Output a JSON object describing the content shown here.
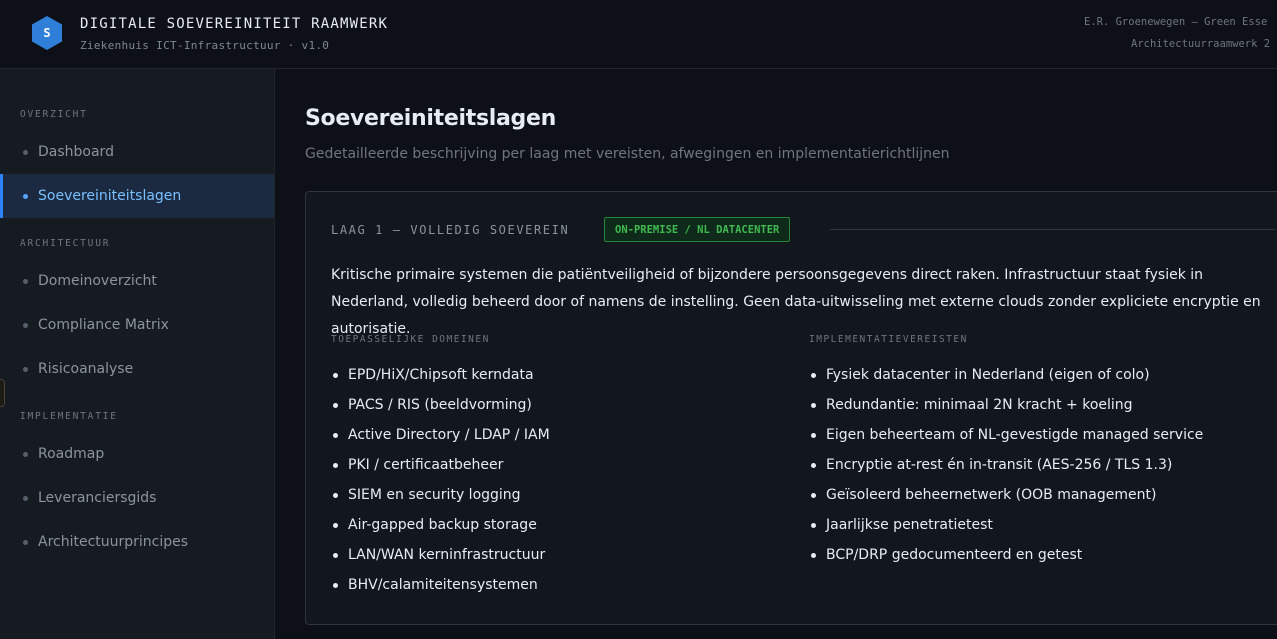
{
  "header": {
    "logo_letter": "S",
    "title": "DIGITALE SOEVEREINITEIT RAAMWERK",
    "subtitle": "Ziekenhuis ICT-Infrastructuur · v1.0",
    "author_line": "E.R. Groenewegen — Green Esse",
    "doc_line": "Architectuurraamwerk 2"
  },
  "sidebar": {
    "sections": [
      {
        "label": "OVERZICHT",
        "items": [
          {
            "label": "Dashboard",
            "active": false
          },
          {
            "label": "Soevereiniteitslagen",
            "active": true
          }
        ]
      },
      {
        "label": "ARCHITECTUUR",
        "items": [
          {
            "label": "Domeinoverzicht",
            "active": false
          },
          {
            "label": "Compliance Matrix",
            "active": false
          },
          {
            "label": "Risicoanalyse",
            "active": false
          }
        ]
      },
      {
        "label": "IMPLEMENTATIE",
        "items": [
          {
            "label": "Roadmap",
            "active": false
          },
          {
            "label": "Leveranciersgids",
            "active": false
          },
          {
            "label": "Architectuurprincipes",
            "active": false
          }
        ]
      }
    ]
  },
  "main": {
    "title": "Soevereiniteitslagen",
    "subtitle": "Gedetailleerde beschrijving per laag met vereisten, afwegingen en implementatierichtlijnen",
    "layer": {
      "label": "LAAG 1 — VOLLEDIG SOEVEREIN",
      "badge": "ON-PREMISE / NL DATACENTER",
      "badge_color": "#3fb950",
      "description": "Kritische primaire systemen die patiëntveiligheid of bijzondere persoonsgegevens direct raken. Infrastructuur staat fysiek in Nederland, volledig beheerd door of namens de instelling. Geen data-uitwisseling met externe clouds zonder expliciete encryptie en autorisatie.",
      "domains_heading": "TOEPASSELIJKE DOMEINEN",
      "domains": [
        "EPD/HiX/Chipsoft kerndata",
        "PACS / RIS (beeldvorming)",
        "Active Directory / LDAP / IAM",
        "PKI / certificaatbeheer",
        "SIEM en security logging",
        "Air-gapped backup storage",
        "LAN/WAN kerninfrastructuur",
        "BHV/calamiteitensystemen"
      ],
      "requirements_heading": "IMPLEMENTATIEVEREISTEN",
      "requirements": [
        "Fysiek datacenter in Nederland (eigen of colo)",
        "Redundantie: minimaal 2N kracht + koeling",
        "Eigen beheerteam of NL-gevestigde managed service",
        "Encryptie at-rest én in-transit (AES-256 / TLS 1.3)",
        "Geïsoleerd beheernetwerk (OOB management)",
        "Jaarlijkse penetratietest",
        "BCP/DRP gedocumenteerd en getest"
      ]
    }
  }
}
